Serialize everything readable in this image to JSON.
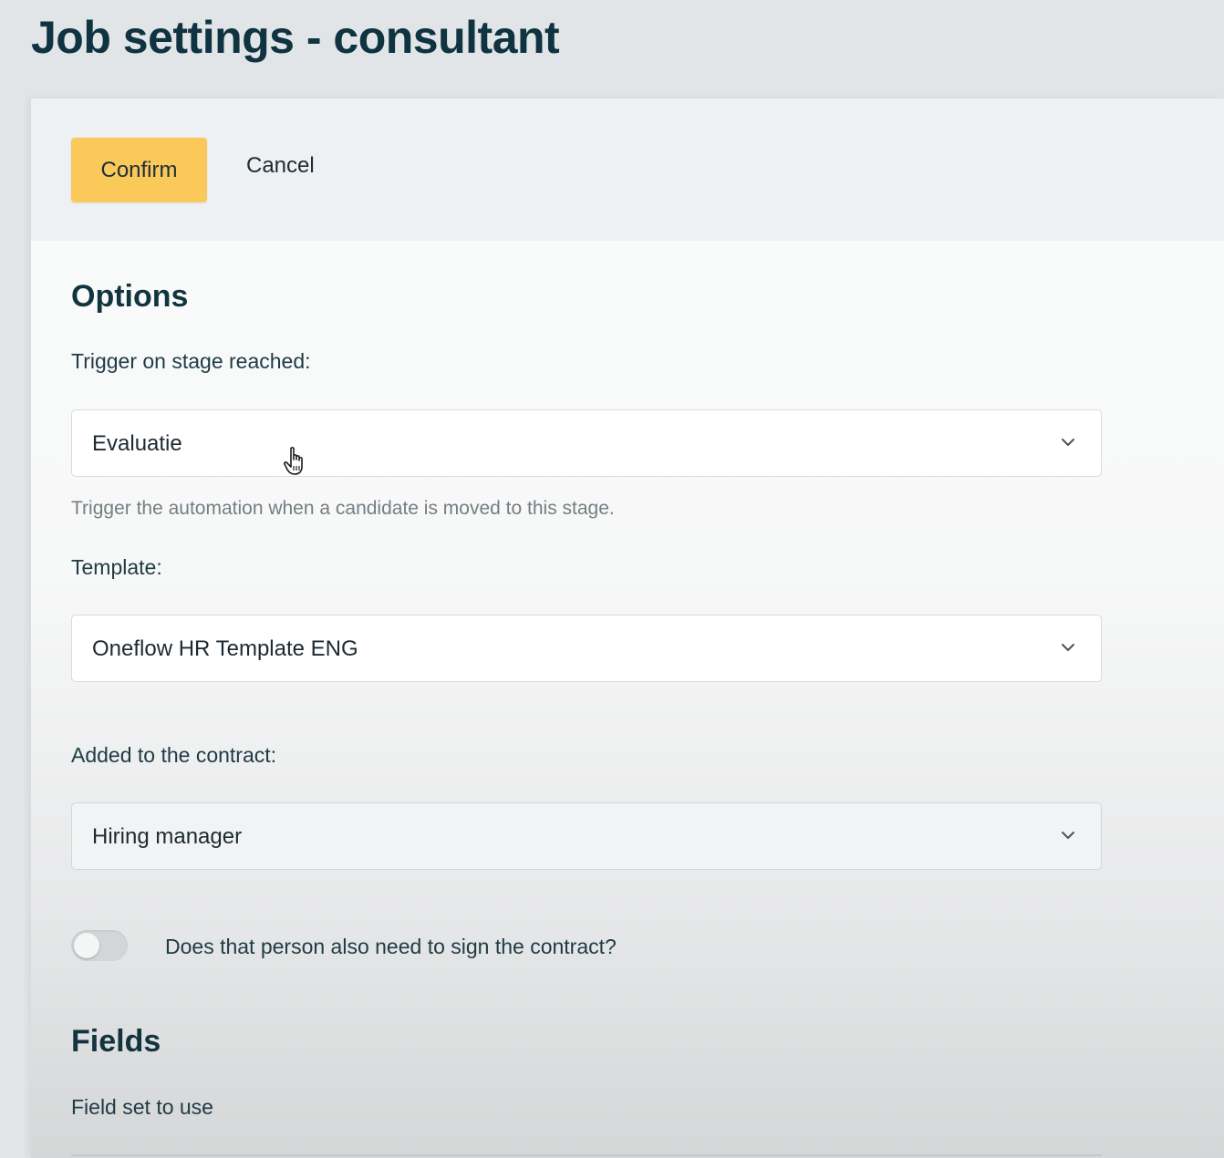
{
  "page": {
    "title": "Job settings - consultant"
  },
  "actions": {
    "confirm_label": "Confirm",
    "cancel_label": "Cancel"
  },
  "options": {
    "heading": "Options",
    "trigger": {
      "label": "Trigger on stage reached:",
      "value": "Evaluatie",
      "helper": "Trigger the automation when a candidate is moved to this stage."
    },
    "template": {
      "label": "Template:",
      "value": "Oneflow HR Template ENG"
    },
    "added_to_contract": {
      "label": "Added to the contract:",
      "value": "Hiring manager"
    },
    "sign_toggle": {
      "label": "Does that person also need to sign the contract?",
      "enabled": false
    }
  },
  "fields": {
    "heading": "Fields",
    "field_set_label": "Field set to use"
  },
  "colors": {
    "accent": "#fbc85a",
    "heading": "#0f3340"
  },
  "icons": [
    "chevron-down-icon",
    "hand-cursor-icon"
  ]
}
